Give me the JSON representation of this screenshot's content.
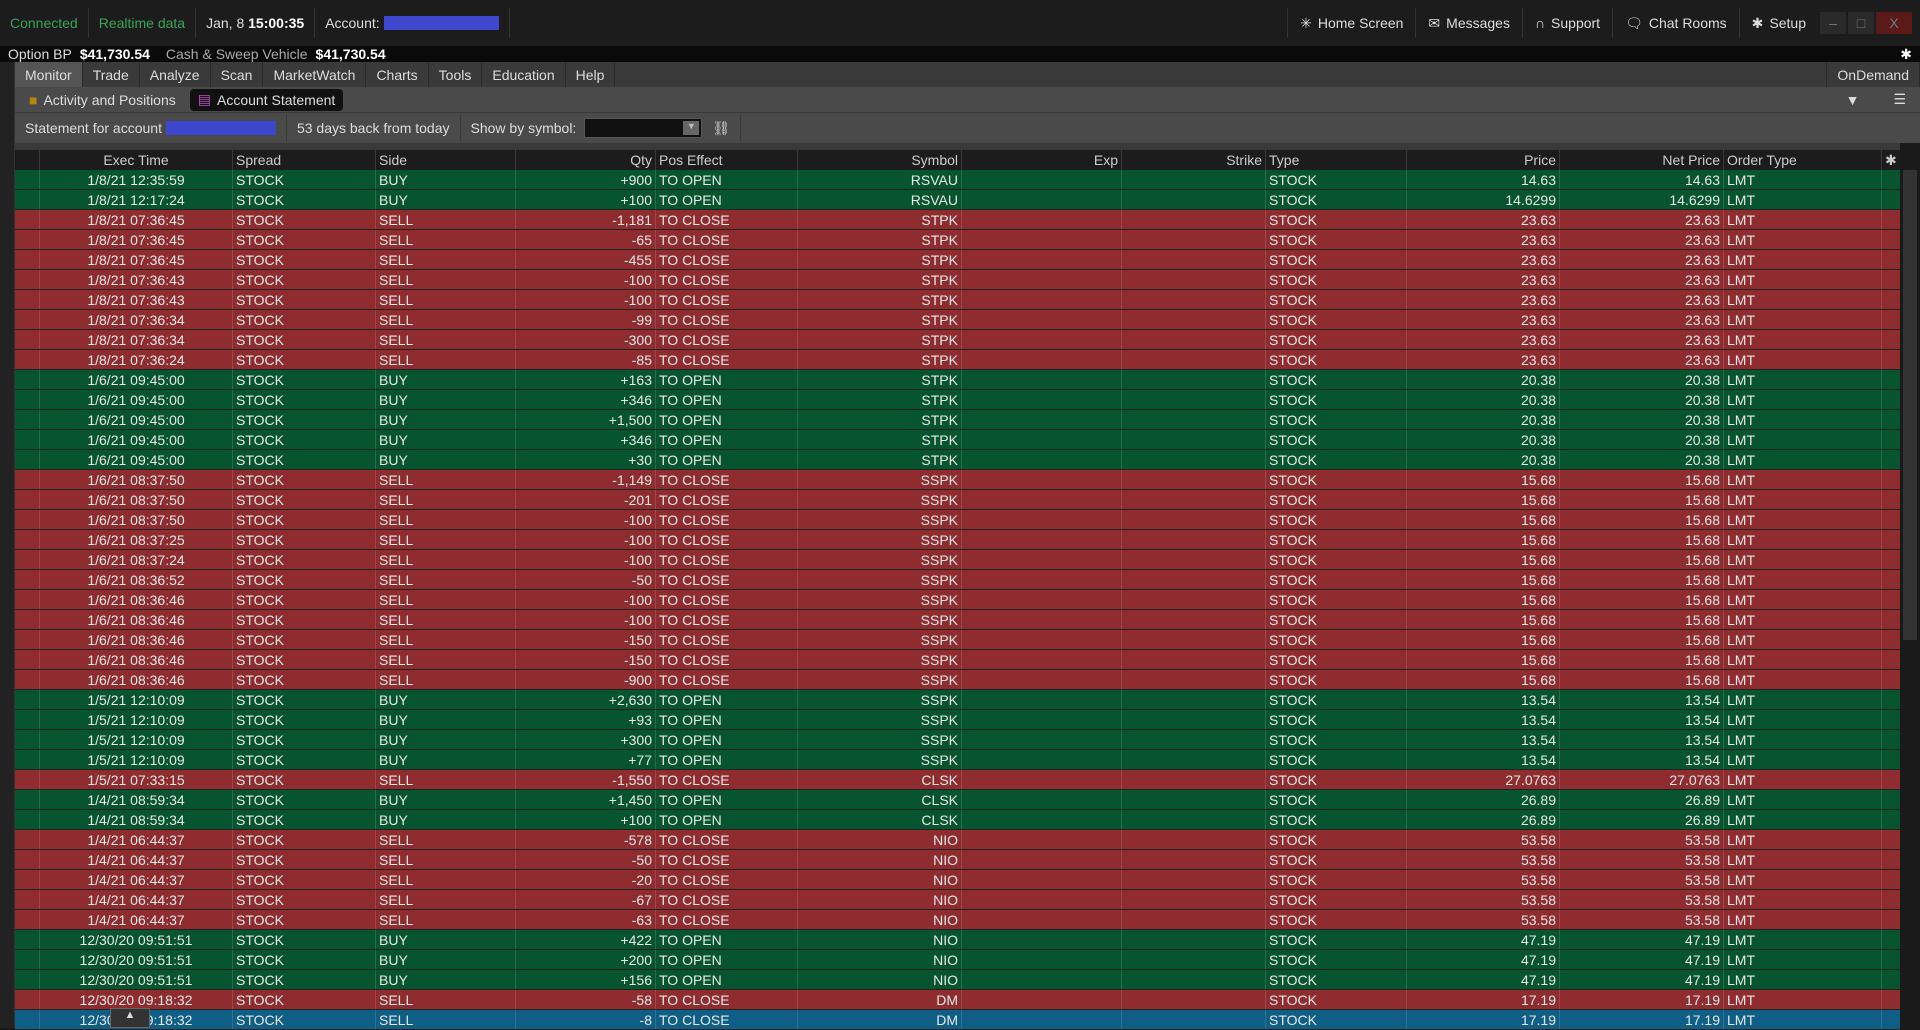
{
  "status": {
    "connected": "Connected",
    "realtime": "Realtime data",
    "date": "Jan, 8",
    "time": "15:00:35",
    "account_label": "Account:"
  },
  "top_right": {
    "home": "Home Screen",
    "messages": "Messages",
    "support": "Support",
    "chat": "Chat Rooms",
    "setup": "Setup",
    "close": "X"
  },
  "balances": {
    "option_bp_label": "Option BP",
    "option_bp": "$41,730.54",
    "cash_label": "Cash & Sweep Vehicle",
    "cash": "$41,730.54"
  },
  "menu": [
    "Monitor",
    "Trade",
    "Analyze",
    "Scan",
    "MarketWatch",
    "Charts",
    "Tools",
    "Education",
    "Help"
  ],
  "ondemand": "OnDemand",
  "subtabs": [
    "Activity and Positions",
    "Account Statement"
  ],
  "statement": {
    "label": "Statement for account",
    "days": "53 days back from today",
    "show_by": "Show by symbol:"
  },
  "columns": [
    "",
    "Exec Time",
    "Spread",
    "Side",
    "Qty",
    "Pos Effect",
    "Symbol",
    "Exp",
    "Strike",
    "Type",
    "Price",
    "Net Price",
    "Order Type"
  ],
  "colors": {
    "buy": "#07552f",
    "sell": "#8f2c2f",
    "selected": "#0e5e85"
  },
  "rows": [
    [
      "1/8/21 12:35:59",
      "STOCK",
      "BUY",
      "+900",
      "TO OPEN",
      "RSVAU",
      "",
      "",
      "STOCK",
      "14.63",
      "14.63",
      "LMT"
    ],
    [
      "1/8/21 12:17:24",
      "STOCK",
      "BUY",
      "+100",
      "TO OPEN",
      "RSVAU",
      "",
      "",
      "STOCK",
      "14.6299",
      "14.6299",
      "LMT"
    ],
    [
      "1/8/21 07:36:45",
      "STOCK",
      "SELL",
      "-1,181",
      "TO CLOSE",
      "STPK",
      "",
      "",
      "STOCK",
      "23.63",
      "23.63",
      "LMT"
    ],
    [
      "1/8/21 07:36:45",
      "STOCK",
      "SELL",
      "-65",
      "TO CLOSE",
      "STPK",
      "",
      "",
      "STOCK",
      "23.63",
      "23.63",
      "LMT"
    ],
    [
      "1/8/21 07:36:45",
      "STOCK",
      "SELL",
      "-455",
      "TO CLOSE",
      "STPK",
      "",
      "",
      "STOCK",
      "23.63",
      "23.63",
      "LMT"
    ],
    [
      "1/8/21 07:36:43",
      "STOCK",
      "SELL",
      "-100",
      "TO CLOSE",
      "STPK",
      "",
      "",
      "STOCK",
      "23.63",
      "23.63",
      "LMT"
    ],
    [
      "1/8/21 07:36:43",
      "STOCK",
      "SELL",
      "-100",
      "TO CLOSE",
      "STPK",
      "",
      "",
      "STOCK",
      "23.63",
      "23.63",
      "LMT"
    ],
    [
      "1/8/21 07:36:34",
      "STOCK",
      "SELL",
      "-99",
      "TO CLOSE",
      "STPK",
      "",
      "",
      "STOCK",
      "23.63",
      "23.63",
      "LMT"
    ],
    [
      "1/8/21 07:36:34",
      "STOCK",
      "SELL",
      "-300",
      "TO CLOSE",
      "STPK",
      "",
      "",
      "STOCK",
      "23.63",
      "23.63",
      "LMT"
    ],
    [
      "1/8/21 07:36:24",
      "STOCK",
      "SELL",
      "-85",
      "TO CLOSE",
      "STPK",
      "",
      "",
      "STOCK",
      "23.63",
      "23.63",
      "LMT"
    ],
    [
      "1/6/21 09:45:00",
      "STOCK",
      "BUY",
      "+163",
      "TO OPEN",
      "STPK",
      "",
      "",
      "STOCK",
      "20.38",
      "20.38",
      "LMT"
    ],
    [
      "1/6/21 09:45:00",
      "STOCK",
      "BUY",
      "+346",
      "TO OPEN",
      "STPK",
      "",
      "",
      "STOCK",
      "20.38",
      "20.38",
      "LMT"
    ],
    [
      "1/6/21 09:45:00",
      "STOCK",
      "BUY",
      "+1,500",
      "TO OPEN",
      "STPK",
      "",
      "",
      "STOCK",
      "20.38",
      "20.38",
      "LMT"
    ],
    [
      "1/6/21 09:45:00",
      "STOCK",
      "BUY",
      "+346",
      "TO OPEN",
      "STPK",
      "",
      "",
      "STOCK",
      "20.38",
      "20.38",
      "LMT"
    ],
    [
      "1/6/21 09:45:00",
      "STOCK",
      "BUY",
      "+30",
      "TO OPEN",
      "STPK",
      "",
      "",
      "STOCK",
      "20.38",
      "20.38",
      "LMT"
    ],
    [
      "1/6/21 08:37:50",
      "STOCK",
      "SELL",
      "-1,149",
      "TO CLOSE",
      "SSPK",
      "",
      "",
      "STOCK",
      "15.68",
      "15.68",
      "LMT"
    ],
    [
      "1/6/21 08:37:50",
      "STOCK",
      "SELL",
      "-201",
      "TO CLOSE",
      "SSPK",
      "",
      "",
      "STOCK",
      "15.68",
      "15.68",
      "LMT"
    ],
    [
      "1/6/21 08:37:50",
      "STOCK",
      "SELL",
      "-100",
      "TO CLOSE",
      "SSPK",
      "",
      "",
      "STOCK",
      "15.68",
      "15.68",
      "LMT"
    ],
    [
      "1/6/21 08:37:25",
      "STOCK",
      "SELL",
      "-100",
      "TO CLOSE",
      "SSPK",
      "",
      "",
      "STOCK",
      "15.68",
      "15.68",
      "LMT"
    ],
    [
      "1/6/21 08:37:24",
      "STOCK",
      "SELL",
      "-100",
      "TO CLOSE",
      "SSPK",
      "",
      "",
      "STOCK",
      "15.68",
      "15.68",
      "LMT"
    ],
    [
      "1/6/21 08:36:52",
      "STOCK",
      "SELL",
      "-50",
      "TO CLOSE",
      "SSPK",
      "",
      "",
      "STOCK",
      "15.68",
      "15.68",
      "LMT"
    ],
    [
      "1/6/21 08:36:46",
      "STOCK",
      "SELL",
      "-100",
      "TO CLOSE",
      "SSPK",
      "",
      "",
      "STOCK",
      "15.68",
      "15.68",
      "LMT"
    ],
    [
      "1/6/21 08:36:46",
      "STOCK",
      "SELL",
      "-100",
      "TO CLOSE",
      "SSPK",
      "",
      "",
      "STOCK",
      "15.68",
      "15.68",
      "LMT"
    ],
    [
      "1/6/21 08:36:46",
      "STOCK",
      "SELL",
      "-150",
      "TO CLOSE",
      "SSPK",
      "",
      "",
      "STOCK",
      "15.68",
      "15.68",
      "LMT"
    ],
    [
      "1/6/21 08:36:46",
      "STOCK",
      "SELL",
      "-150",
      "TO CLOSE",
      "SSPK",
      "",
      "",
      "STOCK",
      "15.68",
      "15.68",
      "LMT"
    ],
    [
      "1/6/21 08:36:46",
      "STOCK",
      "SELL",
      "-900",
      "TO CLOSE",
      "SSPK",
      "",
      "",
      "STOCK",
      "15.68",
      "15.68",
      "LMT"
    ],
    [
      "1/5/21 12:10:09",
      "STOCK",
      "BUY",
      "+2,630",
      "TO OPEN",
      "SSPK",
      "",
      "",
      "STOCK",
      "13.54",
      "13.54",
      "LMT"
    ],
    [
      "1/5/21 12:10:09",
      "STOCK",
      "BUY",
      "+93",
      "TO OPEN",
      "SSPK",
      "",
      "",
      "STOCK",
      "13.54",
      "13.54",
      "LMT"
    ],
    [
      "1/5/21 12:10:09",
      "STOCK",
      "BUY",
      "+300",
      "TO OPEN",
      "SSPK",
      "",
      "",
      "STOCK",
      "13.54",
      "13.54",
      "LMT"
    ],
    [
      "1/5/21 12:10:09",
      "STOCK",
      "BUY",
      "+77",
      "TO OPEN",
      "SSPK",
      "",
      "",
      "STOCK",
      "13.54",
      "13.54",
      "LMT"
    ],
    [
      "1/5/21 07:33:15",
      "STOCK",
      "SELL",
      "-1,550",
      "TO CLOSE",
      "CLSK",
      "",
      "",
      "STOCK",
      "27.0763",
      "27.0763",
      "LMT"
    ],
    [
      "1/4/21 08:59:34",
      "STOCK",
      "BUY",
      "+1,450",
      "TO OPEN",
      "CLSK",
      "",
      "",
      "STOCK",
      "26.89",
      "26.89",
      "LMT"
    ],
    [
      "1/4/21 08:59:34",
      "STOCK",
      "BUY",
      "+100",
      "TO OPEN",
      "CLSK",
      "",
      "",
      "STOCK",
      "26.89",
      "26.89",
      "LMT"
    ],
    [
      "1/4/21 06:44:37",
      "STOCK",
      "SELL",
      "-578",
      "TO CLOSE",
      "NIO",
      "",
      "",
      "STOCK",
      "53.58",
      "53.58",
      "LMT"
    ],
    [
      "1/4/21 06:44:37",
      "STOCK",
      "SELL",
      "-50",
      "TO CLOSE",
      "NIO",
      "",
      "",
      "STOCK",
      "53.58",
      "53.58",
      "LMT"
    ],
    [
      "1/4/21 06:44:37",
      "STOCK",
      "SELL",
      "-20",
      "TO CLOSE",
      "NIO",
      "",
      "",
      "STOCK",
      "53.58",
      "53.58",
      "LMT"
    ],
    [
      "1/4/21 06:44:37",
      "STOCK",
      "SELL",
      "-67",
      "TO CLOSE",
      "NIO",
      "",
      "",
      "STOCK",
      "53.58",
      "53.58",
      "LMT"
    ],
    [
      "1/4/21 06:44:37",
      "STOCK",
      "SELL",
      "-63",
      "TO CLOSE",
      "NIO",
      "",
      "",
      "STOCK",
      "53.58",
      "53.58",
      "LMT"
    ],
    [
      "12/30/20 09:51:51",
      "STOCK",
      "BUY",
      "+422",
      "TO OPEN",
      "NIO",
      "",
      "",
      "STOCK",
      "47.19",
      "47.19",
      "LMT"
    ],
    [
      "12/30/20 09:51:51",
      "STOCK",
      "BUY",
      "+200",
      "TO OPEN",
      "NIO",
      "",
      "",
      "STOCK",
      "47.19",
      "47.19",
      "LMT"
    ],
    [
      "12/30/20 09:51:51",
      "STOCK",
      "BUY",
      "+156",
      "TO OPEN",
      "NIO",
      "",
      "",
      "STOCK",
      "47.19",
      "47.19",
      "LMT"
    ],
    [
      "12/30/20 09:18:32",
      "STOCK",
      "SELL",
      "-58",
      "TO CLOSE",
      "DM",
      "",
      "",
      "STOCK",
      "17.19",
      "17.19",
      "LMT"
    ],
    [
      "12/30/20 09:18:32",
      "STOCK",
      "SELL",
      "-8",
      "TO CLOSE",
      "DM",
      "",
      "",
      "STOCK",
      "17.19",
      "17.19",
      "LMT"
    ]
  ],
  "selected_row": 42
}
